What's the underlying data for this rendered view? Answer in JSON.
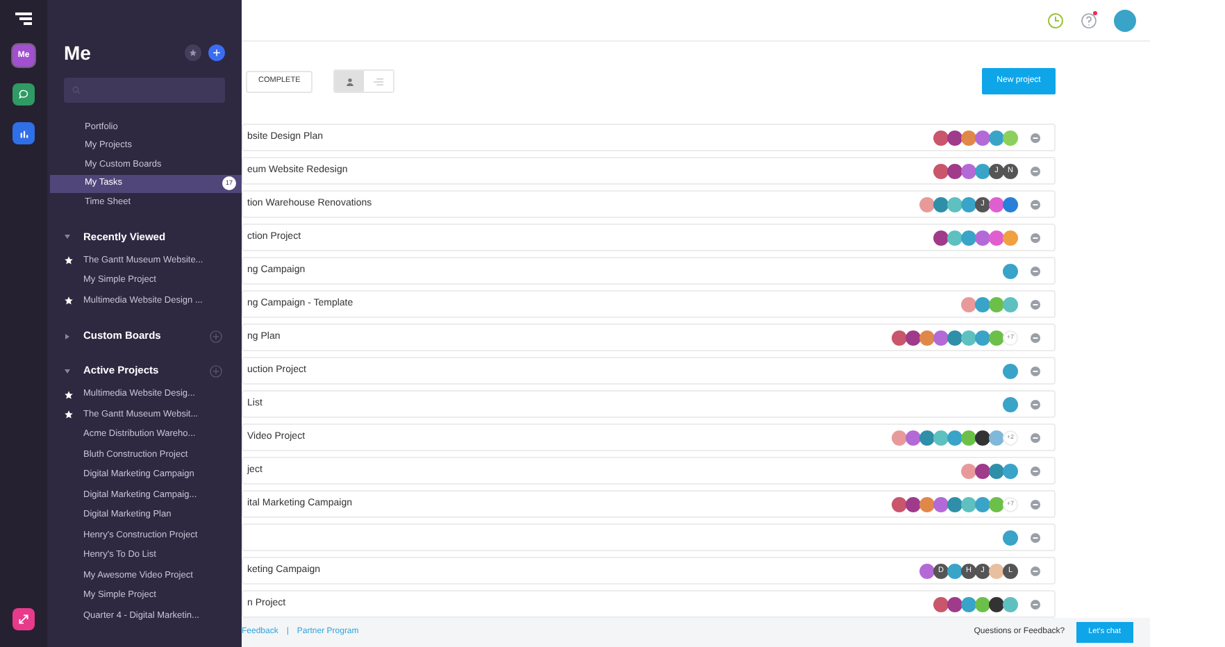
{
  "rail": {
    "items": [
      {
        "kind": "me",
        "label": "Me",
        "color": "#a24fd0",
        "selected": true
      },
      {
        "kind": "chat",
        "color": "#2f9a63",
        "selected": false
      },
      {
        "kind": "chart",
        "color": "#2f6fe8",
        "selected": false
      }
    ]
  },
  "sidebar": {
    "title": "Me",
    "nav": [
      {
        "label": "Portfolio",
        "selected": false
      },
      {
        "label": "My Projects",
        "selected": false
      },
      {
        "label": "My Custom Boards",
        "selected": false
      },
      {
        "label": "My Tasks",
        "selected": true,
        "badge": "17"
      },
      {
        "label": "Time Sheet",
        "selected": false
      }
    ],
    "sections": [
      {
        "title": "Recently Viewed",
        "expanded": true,
        "addable": false,
        "items": [
          {
            "label": "The Gantt Museum Website...",
            "starred": true
          },
          {
            "label": "My Simple Project",
            "starred": false
          },
          {
            "label": "Multimedia Website Design ...",
            "starred": true
          }
        ]
      },
      {
        "title": "Custom Boards",
        "expanded": false,
        "addable": true
      },
      {
        "title": "Active Projects",
        "expanded": true,
        "addable": true,
        "items": [
          {
            "label": "Multimedia Website Desig...",
            "starred": true
          },
          {
            "label": "The Gantt Museum Websit...",
            "starred": true
          },
          {
            "label": "Acme Distribution Wareho...",
            "starred": false
          },
          {
            "label": "Bluth Construction Project",
            "starred": false
          },
          {
            "label": "Digital Marketing Campaign",
            "starred": false
          },
          {
            "label": "Digital Marketing Campaig...",
            "starred": false
          },
          {
            "label": "Digital Marketing Plan",
            "starred": false
          },
          {
            "label": "Henry's Construction Project",
            "starred": false
          },
          {
            "label": "Henry's To Do List",
            "starred": false
          },
          {
            "label": "My Awesome Video Project",
            "starred": false
          },
          {
            "label": "My Simple Project",
            "starred": false
          },
          {
            "label": "Quarter 4 - Digital Marketin...",
            "starred": false
          }
        ]
      }
    ]
  },
  "toolbar": {
    "filter": "COMPLETE",
    "views": [
      {
        "kind": "people",
        "selected": true
      },
      {
        "kind": "list",
        "selected": false
      }
    ],
    "new_button": "New project"
  },
  "projects": [
    {
      "name": "bsite Design Plan",
      "avatars": [
        {
          "kind": "photo",
          "color": "#c9566b"
        },
        {
          "kind": "photo",
          "color": "#a03a8a"
        },
        {
          "kind": "photo",
          "color": "#e0884a"
        },
        {
          "kind": "photo",
          "color": "#b36ad6"
        },
        {
          "kind": "photo",
          "color": "#3aa3c8"
        },
        {
          "kind": "photo",
          "color": "#8ccf5a"
        }
      ]
    },
    {
      "name": "eum Website Redesign",
      "avatars": [
        {
          "kind": "photo",
          "color": "#c9566b"
        },
        {
          "kind": "photo",
          "color": "#a03a8a"
        },
        {
          "kind": "photo",
          "color": "#b36ad6"
        },
        {
          "kind": "photo",
          "color": "#3aa3c8"
        },
        {
          "kind": "initial",
          "text": "J"
        },
        {
          "kind": "initial",
          "text": "N"
        }
      ]
    },
    {
      "name": "tion Warehouse Renovations",
      "avatars": [
        {
          "kind": "photo",
          "color": "#e89a9a"
        },
        {
          "kind": "photo",
          "color": "#2f8fa8"
        },
        {
          "kind": "photo",
          "color": "#5fc0c0"
        },
        {
          "kind": "photo",
          "color": "#3aa3c8"
        },
        {
          "kind": "initial",
          "text": "J"
        },
        {
          "kind": "photo",
          "color": "#e05fd0"
        },
        {
          "kind": "photo",
          "color": "#2a80d8"
        }
      ]
    },
    {
      "name": "ction Project",
      "avatars": [
        {
          "kind": "photo",
          "color": "#a03a8a"
        },
        {
          "kind": "photo",
          "color": "#5fc0c0"
        },
        {
          "kind": "photo",
          "color": "#3aa3c8"
        },
        {
          "kind": "photo",
          "color": "#b36ad6"
        },
        {
          "kind": "photo",
          "color": "#e05fd0"
        },
        {
          "kind": "photo",
          "color": "#f0a040"
        }
      ]
    },
    {
      "name": "ng Campaign",
      "avatars": [
        {
          "kind": "photo",
          "color": "#3aa3c8"
        }
      ]
    },
    {
      "name": "ng Campaign - Template",
      "avatars": [
        {
          "kind": "photo",
          "color": "#e89a9a"
        },
        {
          "kind": "photo",
          "color": "#3aa3c8"
        },
        {
          "kind": "photo",
          "color": "#6cc04a"
        },
        {
          "kind": "photo",
          "color": "#5fc0c0"
        }
      ]
    },
    {
      "name": "ng Plan",
      "avatars": [
        {
          "kind": "photo",
          "color": "#c9566b"
        },
        {
          "kind": "photo",
          "color": "#a03a8a"
        },
        {
          "kind": "photo",
          "color": "#e0884a"
        },
        {
          "kind": "photo",
          "color": "#b36ad6"
        },
        {
          "kind": "photo",
          "color": "#2f8fa8"
        },
        {
          "kind": "photo",
          "color": "#5fc0c0"
        },
        {
          "kind": "photo",
          "color": "#3aa3c8"
        },
        {
          "kind": "photo",
          "color": "#6cc04a"
        }
      ],
      "more": "+7"
    },
    {
      "name": "uction Project",
      "avatars": [
        {
          "kind": "photo",
          "color": "#3aa3c8"
        }
      ]
    },
    {
      "name": "List",
      "avatars": [
        {
          "kind": "photo",
          "color": "#3aa3c8"
        }
      ]
    },
    {
      "name": "Video Project",
      "avatars": [
        {
          "kind": "photo",
          "color": "#e89a9a"
        },
        {
          "kind": "photo",
          "color": "#b36ad6"
        },
        {
          "kind": "photo",
          "color": "#2f8fa8"
        },
        {
          "kind": "photo",
          "color": "#5fc0c0"
        },
        {
          "kind": "photo",
          "color": "#3aa3c8"
        },
        {
          "kind": "photo",
          "color": "#6cc04a"
        },
        {
          "kind": "photo",
          "color": "#333333"
        },
        {
          "kind": "photo",
          "color": "#7fb8d8"
        }
      ],
      "more": "+2"
    },
    {
      "name": "ject",
      "avatars": [
        {
          "kind": "photo",
          "color": "#e89a9a"
        },
        {
          "kind": "photo",
          "color": "#a03a8a"
        },
        {
          "kind": "photo",
          "color": "#2f8fa8"
        },
        {
          "kind": "photo",
          "color": "#3aa3c8"
        }
      ]
    },
    {
      "name": "ital Marketing Campaign",
      "avatars": [
        {
          "kind": "photo",
          "color": "#c9566b"
        },
        {
          "kind": "photo",
          "color": "#a03a8a"
        },
        {
          "kind": "photo",
          "color": "#e0884a"
        },
        {
          "kind": "photo",
          "color": "#b36ad6"
        },
        {
          "kind": "photo",
          "color": "#2f8fa8"
        },
        {
          "kind": "photo",
          "color": "#5fc0c0"
        },
        {
          "kind": "photo",
          "color": "#3aa3c8"
        },
        {
          "kind": "photo",
          "color": "#6cc04a"
        }
      ],
      "more": "+7"
    },
    {
      "avatars": [
        {
          "kind": "photo",
          "color": "#3aa3c8"
        }
      ]
    },
    {
      "name": "keting Campaign",
      "avatars": [
        {
          "kind": "photo",
          "color": "#b36ad6"
        },
        {
          "kind": "initial",
          "text": "D"
        },
        {
          "kind": "photo",
          "color": "#3aa3c8"
        },
        {
          "kind": "initial",
          "text": "H"
        },
        {
          "kind": "initial",
          "text": "J"
        },
        {
          "kind": "photo",
          "color": "#e8c0a0"
        },
        {
          "kind": "initial",
          "text": "L"
        }
      ]
    },
    {
      "name": "n Project",
      "avatars": [
        {
          "kind": "photo",
          "color": "#c9566b"
        },
        {
          "kind": "photo",
          "color": "#a03a8a"
        },
        {
          "kind": "photo",
          "color": "#3aa3c8"
        },
        {
          "kind": "photo",
          "color": "#6cc04a"
        },
        {
          "kind": "photo",
          "color": "#333333"
        },
        {
          "kind": "photo",
          "color": "#5fc0c0"
        }
      ]
    }
  ],
  "topbar": {
    "help_unread": true
  },
  "footer": {
    "links": [
      "Feedback",
      "Partner Program"
    ],
    "separator": "|",
    "question": "Questions or Feedback?",
    "chat_button": "Let's chat"
  }
}
